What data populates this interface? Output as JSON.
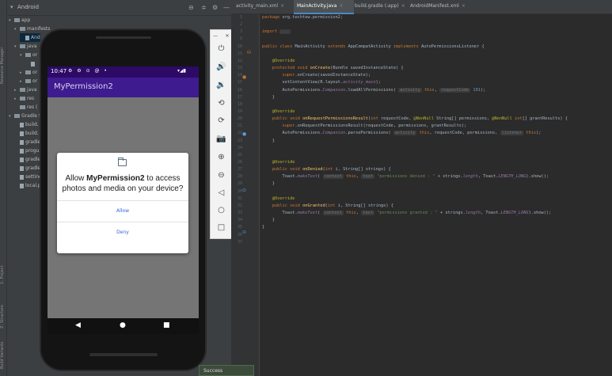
{
  "project_panel": {
    "title": "Android",
    "tree": [
      {
        "label": "app",
        "arrow": "▾",
        "kind": "folder",
        "indent": 0
      },
      {
        "label": "manifests",
        "arrow": "▾",
        "kind": "folder",
        "indent": 1
      },
      {
        "label": "And",
        "arrow": "",
        "kind": "file",
        "indent": 2
      },
      {
        "label": "java",
        "arrow": "▾",
        "kind": "folder",
        "indent": 1
      },
      {
        "label": "or",
        "arrow": "▾",
        "kind": "folder",
        "indent": 2
      },
      {
        "label": "",
        "arrow": "",
        "kind": "file",
        "indent": 3
      },
      {
        "label": "or",
        "arrow": "▸",
        "kind": "folder",
        "indent": 2
      },
      {
        "label": "or",
        "arrow": "▸",
        "kind": "folder",
        "indent": 2
      },
      {
        "label": "java",
        "arrow": "▸",
        "kind": "folder",
        "indent": 1
      },
      {
        "label": "res",
        "arrow": "▸",
        "kind": "folder",
        "indent": 1
      },
      {
        "label": "res (",
        "arrow": "",
        "kind": "folder",
        "indent": 1
      },
      {
        "label": "Gradle Sc",
        "arrow": "▾",
        "kind": "folder",
        "indent": 0
      },
      {
        "label": "build.",
        "arrow": "",
        "kind": "file",
        "indent": 1
      },
      {
        "label": "build.",
        "arrow": "",
        "kind": "file",
        "indent": 1
      },
      {
        "label": "gradle",
        "arrow": "",
        "kind": "file",
        "indent": 1
      },
      {
        "label": "progu",
        "arrow": "",
        "kind": "file",
        "indent": 1
      },
      {
        "label": "gradle",
        "arrow": "",
        "kind": "file",
        "indent": 1
      },
      {
        "label": "gradle",
        "arrow": "",
        "kind": "file",
        "indent": 1
      },
      {
        "label": "setting",
        "arrow": "",
        "kind": "file",
        "indent": 1
      },
      {
        "label": "local.p",
        "arrow": "",
        "kind": "file",
        "indent": 1
      }
    ],
    "side_labels": [
      "Resource Manager",
      "1: Project",
      "Z: Structure",
      "Build Variants"
    ]
  },
  "editor_tabs": [
    {
      "label": "activity_main.xml",
      "active": false
    },
    {
      "label": "MainActivity.java",
      "active": true
    },
    {
      "label": "build.gradle (:app)",
      "active": false
    },
    {
      "label": "AndroidManifest.xml",
      "active": false
    }
  ],
  "emulator": {
    "status_time": "10:47",
    "status_icons": "⚙ ⚙ ⊙ @ •",
    "status_right": "▾◢▮",
    "app_title": "MyPermission2",
    "dialog": {
      "text_prefix": "Allow ",
      "app_name": "MyPermission2",
      "text_suffix": " to access photos and media on your device?",
      "allow_label": "Allow",
      "deny_label": "Deny"
    },
    "nav": {
      "back": "◀",
      "home": "●",
      "recents": "■"
    }
  },
  "emulator_toolbar": {
    "minimize": "—",
    "close": "✕",
    "buttons": [
      "⏻",
      "🔊",
      "🔉",
      "⟲",
      "⟳",
      "📷",
      "⊕",
      "⊖",
      "◁",
      "○",
      "□",
      "⋯"
    ]
  },
  "code_lines": [
    {
      "n": "1",
      "html": "<span class='kw'>package</span> org.techtow.permission2;"
    },
    {
      "n": "2",
      "html": ""
    },
    {
      "n": "3",
      "html": "<span class='kw'>import</span> <span class='hint'>...</span>"
    },
    {
      "n": "9",
      "html": ""
    },
    {
      "n": "10",
      "html": "<span class='kw'>public class</span> MainActivity <span class='kw'>extends</span> AppCompatActivity <span class='kw'>implements</span> AutoPermissionsListener {"
    },
    {
      "n": "11",
      "html": ""
    },
    {
      "n": "12",
      "html": "    <span class='ann'>@Override</span>"
    },
    {
      "n": "13",
      "html": "    <span class='kw'>protected void</span> <span class='fn'>onCreate</span>(Bundle savedInstanceState) {"
    },
    {
      "n": "14",
      "html": "        <span class='kw'>super</span>.onCreate(savedInstanceState);"
    },
    {
      "n": "15",
      "html": "        setContentView(R.layout.<span class='it'>activity_main</span>);"
    },
    {
      "n": "16",
      "html": "        AutoPermissions.<span class='it'>Companion</span>.loadAllPermissions( <span class='hint'>activity</span> <span class='kw'>this</span>, <span class='hint'>requestCode</span> <span class='num'>101</span>);"
    },
    {
      "n": "17",
      "html": "    }"
    },
    {
      "n": "18",
      "html": ""
    },
    {
      "n": "19",
      "html": "    <span class='ann'>@Override</span>"
    },
    {
      "n": "20",
      "html": "    <span class='kw'>public void</span> <span class='fn'>onRequestPermissionsResult</span>(<span class='kw'>int</span> requestCode, <span class='ann'>@NonNull</span> String[] permissions, <span class='ann'>@NonNull</span> <span class='kw'>int</span>[] grantResults) {"
    },
    {
      "n": "21",
      "html": "        <span class='kw'>super</span>.onRequestPermissionsResult(requestCode, permissions, grantResults);"
    },
    {
      "n": "22",
      "html": "        AutoPermissions.<span class='it'>Companion</span>.parsePermissions( <span class='hint'>activity</span> <span class='kw'>this</span>, requestCode, permissions, <span class='hint'>listener</span> <span class='kw'>this</span>);"
    },
    {
      "n": "23",
      "html": "    }"
    },
    {
      "n": "24",
      "html": ""
    },
    {
      "n": "25",
      "html": ""
    },
    {
      "n": "26",
      "html": "    <span class='ann'>@Override</span>"
    },
    {
      "n": "27",
      "html": "    <span class='kw'>public void</span> <span class='fn'>onDenied</span>(<span class='kw'>int</span> i, String[] strings) {"
    },
    {
      "n": "28",
      "html": "        Toast.<span class='it'>makeText</span>( <span class='hint'>context</span> <span class='kw'>this</span>, <span class='hint'>text</span> <span class='str'>\"permissions denied : \"</span> + strings.<span class='it'>length</span>, Toast.<span class='it'>LENGTH_LONG</span>).show();"
    },
    {
      "n": "29",
      "html": "    }"
    },
    {
      "n": "30",
      "html": ""
    },
    {
      "n": "31",
      "html": "    <span class='ann'>@Override</span>"
    },
    {
      "n": "32",
      "html": "    <span class='kw'>public void</span> <span class='fn'>onGranted</span>(<span class='kw'>int</span> i, String[] strings) {"
    },
    {
      "n": "33",
      "html": "        Toast.<span class='it'>makeText</span>( <span class='hint'>context</span> <span class='kw'>this</span>, <span class='hint'>text</span> <span class='str'>\"permissions granted : \"</span> + strings.<span class='it'>length</span>, Toast.<span class='it'>LENGTH_LONG</span>).show();"
    },
    {
      "n": "34",
      "html": "    }"
    },
    {
      "n": "35",
      "html": "}"
    },
    {
      "n": "36",
      "html": ""
    },
    {
      "n": "37",
      "html": ""
    }
  ],
  "bottom": {
    "success_text": "Success"
  },
  "colors": {
    "app_bar": "#3e1b8f",
    "status_bar": "#2c0a66",
    "dialog_button": "#3367d6",
    "editor_bg": "#2b2b2b"
  }
}
